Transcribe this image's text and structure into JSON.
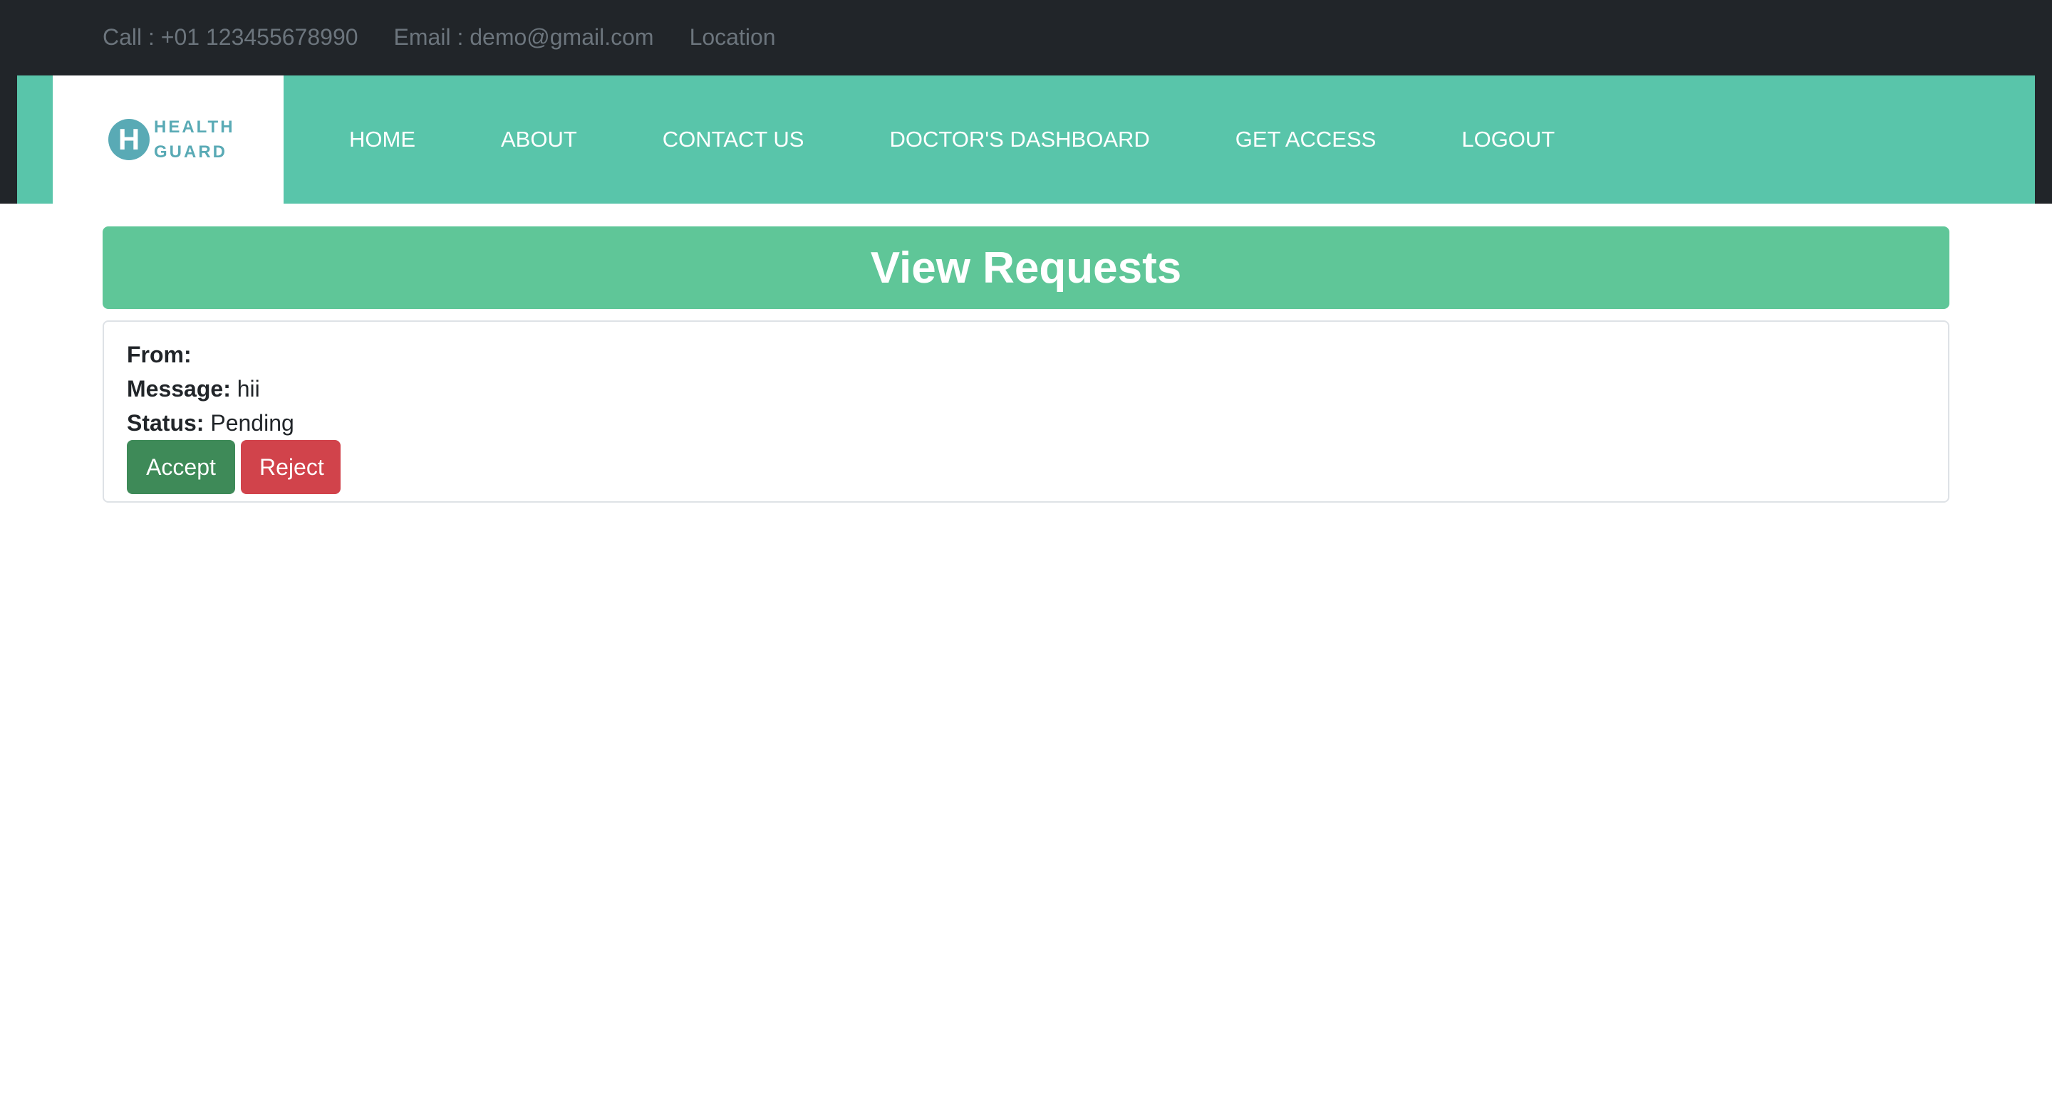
{
  "topbar": {
    "call": "Call : +01 123455678990",
    "email": "Email : demo@gmail.com",
    "location": "Location"
  },
  "brand": {
    "letter": "H",
    "line1": "HEALTH",
    "line2": "GUARD",
    "accent_color": "#59aab5"
  },
  "nav": {
    "items": [
      {
        "label": "HOME"
      },
      {
        "label": "ABOUT"
      },
      {
        "label": "CONTACT US"
      },
      {
        "label": "DOCTOR'S DASHBOARD"
      },
      {
        "label": "GET ACCESS"
      },
      {
        "label": "LOGOUT"
      }
    ],
    "background_color": "#59c5aa"
  },
  "header": {
    "title": "View Requests",
    "background_color": "#5fc698"
  },
  "request": {
    "from_label": "From:",
    "from_value": "",
    "message_label": "Message:",
    "message_value": "hii",
    "status_label": "Status:",
    "status_value": "Pending",
    "accept_label": "Accept",
    "reject_label": "Reject",
    "accept_color": "#3e8a58",
    "reject_color": "#d1434b"
  }
}
